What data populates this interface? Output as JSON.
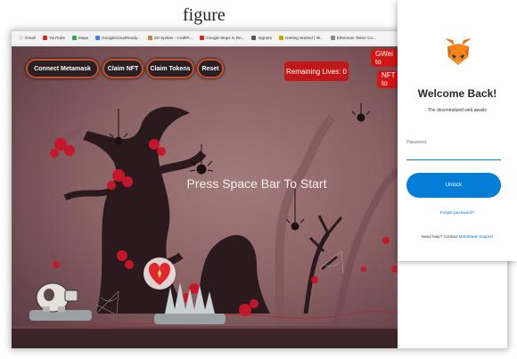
{
  "caption": {
    "visible_text": "figure"
  },
  "bookmarks": [
    {
      "label": "Gmail",
      "color": "#ffffff"
    },
    {
      "label": "YouTube",
      "color": "#e62117"
    },
    {
      "label": "Maps",
      "color": "#34a853"
    },
    {
      "label": "GoogleCloudReady...",
      "color": "#4285f4"
    },
    {
      "label": "2D Sprites - CraftPi...",
      "color": "#c0853a"
    },
    {
      "label": "Google Maps in Re...",
      "color": "#e62117"
    },
    {
      "label": "Signers",
      "color": "#555555"
    },
    {
      "label": "Getting Started | W...",
      "color": "#d6a000"
    },
    {
      "label": "Ethereum Token Co...",
      "color": "#888888"
    }
  ],
  "game": {
    "buttons": {
      "connect": "Connect Metamask",
      "claim_nft": "Claim NFT",
      "claim_tokens": "Claim Tokens",
      "reset": "Reset"
    },
    "lives_label": "Remaining Lives: 0",
    "gwei_tag": "GWei to",
    "nft_tag": "NFT to",
    "prompt": "Press Space Bar To Start"
  },
  "wallet": {
    "title": "Welcome Back!",
    "subtitle": "The decentralized web awaits",
    "password_label": "Password",
    "password_value": "",
    "unlock_label": "Unlock",
    "forgot_label": "Forgot password?",
    "help_prefix": "Need help? Contact ",
    "help_link": "MetaMask Support"
  },
  "colors": {
    "accent_blue": "#037dd6",
    "lives_red": "#c01818",
    "button_border": "#c8502a"
  }
}
